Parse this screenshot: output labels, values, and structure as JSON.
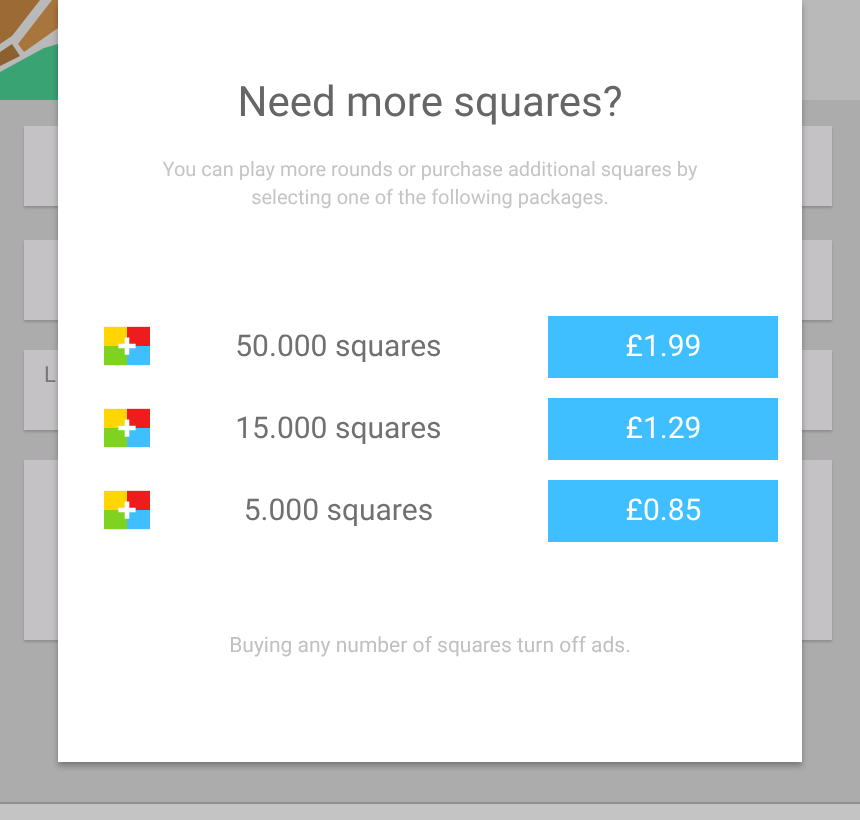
{
  "background": {
    "label": "L"
  },
  "dialog": {
    "title": "Need more squares?",
    "message": "You can play more rounds or purchase additional squares by selecting one of the following packages.",
    "packages": [
      {
        "name": "50.000 squares",
        "price": "£1.99"
      },
      {
        "name": "15.000 squares",
        "price": "£1.29"
      },
      {
        "name": "5.000 squares",
        "price": "£0.85"
      }
    ],
    "footer": "Buying any number of squares turn off ads."
  }
}
